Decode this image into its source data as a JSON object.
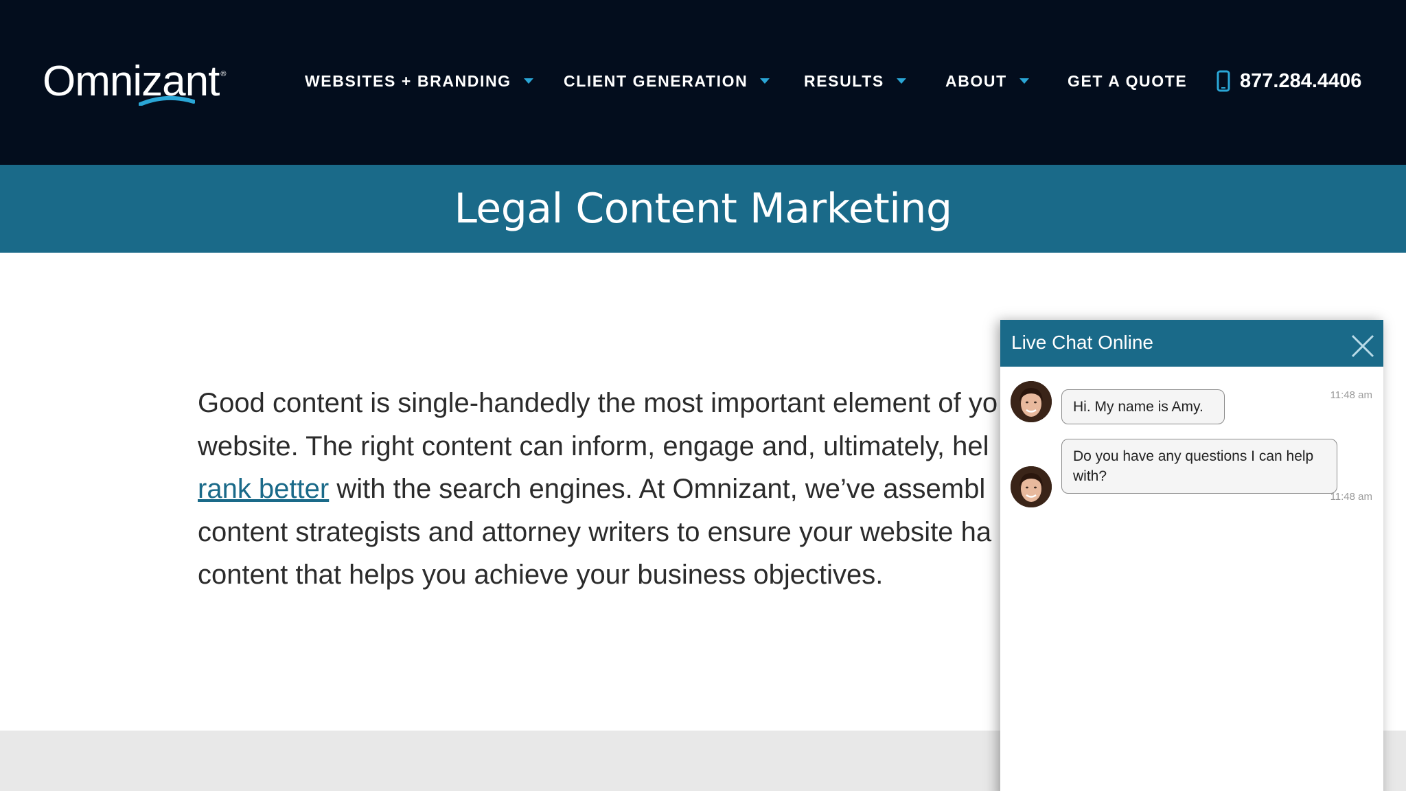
{
  "header": {
    "logo_text": "Omnizant",
    "logo_registered": "®",
    "nav": [
      {
        "label": "WEBSITES + BRANDING",
        "has_dropdown": true
      },
      {
        "label": "CLIENT GENERATION",
        "has_dropdown": true
      },
      {
        "label": "RESULTS",
        "has_dropdown": true
      },
      {
        "label": "ABOUT",
        "has_dropdown": true
      },
      {
        "label": "GET A QUOTE",
        "has_dropdown": false
      }
    ],
    "phone": "877.284.4406",
    "phone_icon": "mobile-phone-icon"
  },
  "hero": {
    "title": "Legal Content Marketing"
  },
  "content": {
    "lines": [
      {
        "text": "Good content is single-handedly the most important element of yo"
      },
      {
        "text": "website. The right content can inform, engage and, ultimately, hel"
      },
      {
        "link": "rank better",
        "text": " with the search engines. At Omnizant, we’ve assembl"
      },
      {
        "text": "content strategists and attorney writers to ensure your website ha"
      },
      {
        "text": "content that helps you achieve your business objectives."
      }
    ]
  },
  "chat": {
    "title": "Live Chat Online",
    "close_icon": "close-icon",
    "messages": [
      {
        "text": "Hi. My name is Amy.",
        "time": "11:48 am"
      },
      {
        "text": "Do you have any questions I can help with?",
        "time": "11:48 am"
      }
    ]
  },
  "colors": {
    "header_bg": "#030d1d",
    "title_band": "#1a6a89",
    "accent": "#2aa6d6",
    "link": "#1a6a89",
    "grey_strip": "#e8e8e8"
  }
}
